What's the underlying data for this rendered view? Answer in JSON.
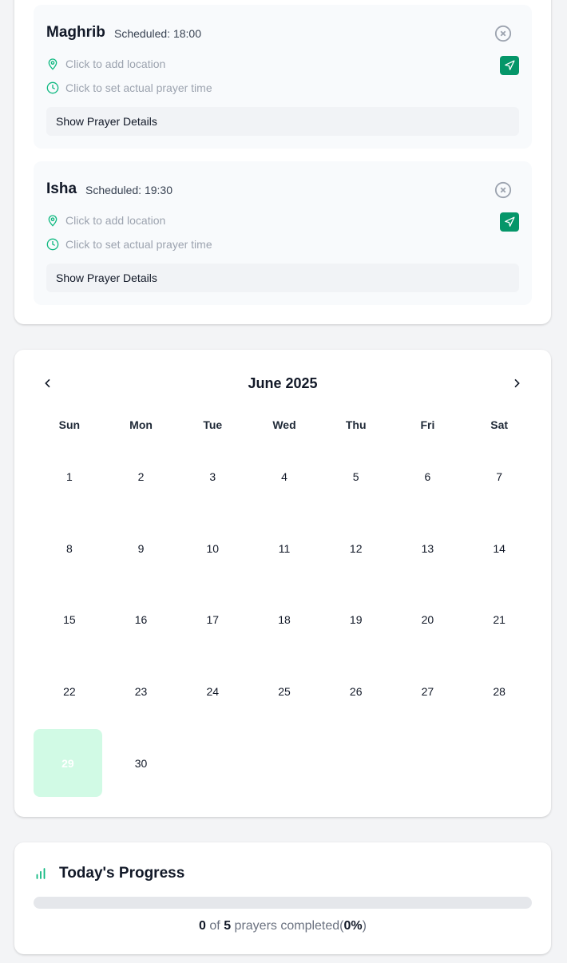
{
  "prayers": [
    {
      "name": "Maghrib",
      "scheduled": "Scheduled: 18:00",
      "location_prompt": "Click to add location",
      "time_prompt": "Click to set actual prayer time",
      "details_label": "Show Prayer Details"
    },
    {
      "name": "Isha",
      "scheduled": "Scheduled: 19:30",
      "location_prompt": "Click to add location",
      "time_prompt": "Click to set actual prayer time",
      "details_label": "Show Prayer Details"
    }
  ],
  "calendar": {
    "title": "June 2025",
    "weekdays": [
      "Sun",
      "Mon",
      "Tue",
      "Wed",
      "Thu",
      "Fri",
      "Sat"
    ],
    "days": [
      "1",
      "2",
      "3",
      "4",
      "5",
      "6",
      "7",
      "8",
      "9",
      "10",
      "11",
      "12",
      "13",
      "14",
      "15",
      "16",
      "17",
      "18",
      "19",
      "20",
      "21",
      "22",
      "23",
      "24",
      "25",
      "26",
      "27",
      "28",
      "29",
      "30"
    ],
    "today": "29"
  },
  "progress": {
    "title": "Today's Progress",
    "completed": "0",
    "of_word": "of",
    "total": "5",
    "suffix": "prayers completed",
    "percent": "0%",
    "fraction": 0
  },
  "icons": {
    "location": "map-pin-icon",
    "time": "clock-icon",
    "navigate": "navigation-arrow-icon",
    "close": "close-circle-icon",
    "progress": "bar-chart-icon",
    "prev": "chevron-left-icon",
    "next": "chevron-right-icon"
  },
  "colors": {
    "accent": "#059669",
    "accent_light": "#d1fae5",
    "muted": "#9ca3af"
  }
}
